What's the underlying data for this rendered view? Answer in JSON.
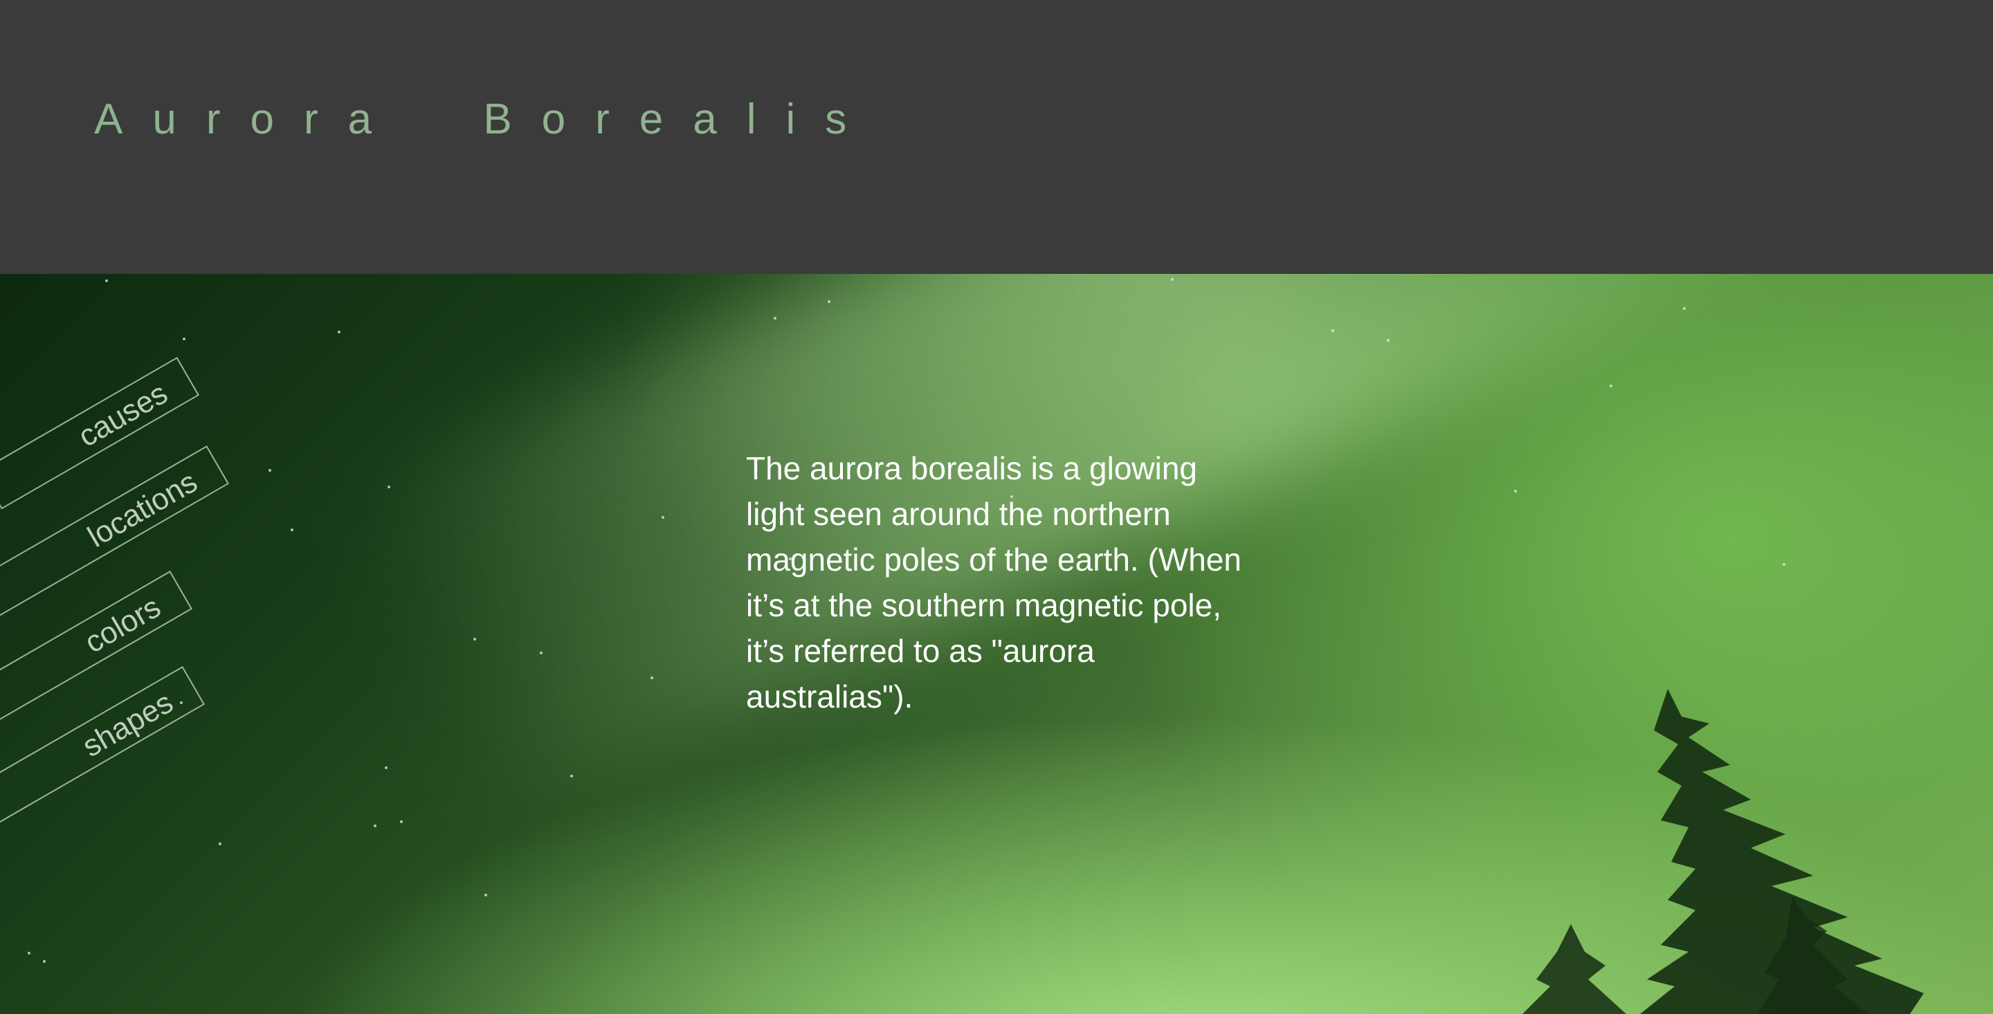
{
  "header": {
    "title": "Aurora Borealis",
    "title_color": "#8fb38f",
    "background": "#3b3b3b"
  },
  "nav": {
    "items": [
      {
        "label": "causes"
      },
      {
        "label": "locations"
      },
      {
        "label": "colors"
      },
      {
        "label": "shapes"
      }
    ]
  },
  "main": {
    "description": "The aurora borealis is a glowing light seen around the northern magnetic poles of the earth. (When it’s at the southern magnetic pole, it’s referred to as \"aurora australias\")."
  }
}
